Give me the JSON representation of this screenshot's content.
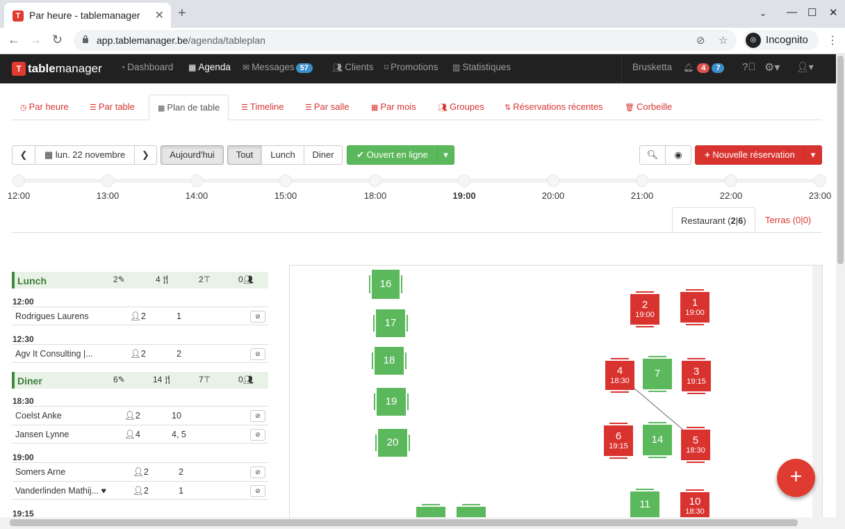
{
  "browser": {
    "tab_title": "Par heure - tablemanager",
    "url_host": "app.tablemanager.be",
    "url_path": "/agenda/tableplan",
    "incognito_label": "Incognito"
  },
  "topnav": {
    "logo_a": "table",
    "logo_b": "manager",
    "items": [
      {
        "label": "Dashboard",
        "icon": "dashboard-icon"
      },
      {
        "label": "Agenda",
        "icon": "calendar-icon"
      },
      {
        "label": "Messages",
        "icon": "envelope-icon",
        "badge": "57"
      },
      {
        "label": "Clients",
        "icon": "users-icon"
      },
      {
        "label": "Promotions",
        "icon": "tag-icon"
      },
      {
        "label": "Statistiques",
        "icon": "bar-chart-icon"
      }
    ],
    "restaurant": "Brusketta",
    "notif_red": "4",
    "notif_blue": "7"
  },
  "subtabs": [
    {
      "label": "Par heure",
      "icon": "clock-icon"
    },
    {
      "label": "Par table",
      "icon": "list-icon"
    },
    {
      "label": "Plan de table",
      "icon": "grid-icon"
    },
    {
      "label": "Timeline",
      "icon": "timeline-icon"
    },
    {
      "label": "Par salle",
      "icon": "list-icon"
    },
    {
      "label": "Par mois",
      "icon": "calendar-icon"
    },
    {
      "label": "Groupes",
      "icon": "group-icon"
    },
    {
      "label": "Réservations récentes",
      "icon": "sort-icon"
    },
    {
      "label": "Corbeille",
      "icon": "trash-icon"
    }
  ],
  "toolbar": {
    "date": "lun. 22 novembre",
    "today": "Aujourd'hui",
    "filters": [
      "Tout",
      "Lunch",
      "Diner"
    ],
    "online": "Ouvert en ligne",
    "new_reservation": "Nouvelle réservation"
  },
  "timeline": [
    "12:00",
    "13:00",
    "14:00",
    "15:00",
    "18:00",
    "19:00",
    "20:00",
    "21:00",
    "22:00",
    "23:00"
  ],
  "timeline_active": "19:00",
  "rooms": {
    "restaurant_label": "Restaurant (",
    "restaurant_a": "2",
    "restaurant_sep": "|",
    "restaurant_b": "6",
    "restaurant_close": ")",
    "terras": "Terras (0|0)"
  },
  "lunch": {
    "title": "Lunch",
    "stats": [
      "2",
      "4",
      "2",
      "0"
    ],
    "groups": [
      {
        "time": "12:00",
        "rows": [
          {
            "name": "Rodrigues Laurens",
            "people": "2",
            "table": "1"
          }
        ]
      },
      {
        "time": "12:30",
        "rows": [
          {
            "name": "Agv It Consulting |...",
            "people": "2",
            "table": "2"
          }
        ]
      }
    ]
  },
  "diner": {
    "title": "Diner",
    "stats": [
      "6",
      "14",
      "7",
      "0"
    ],
    "groups": [
      {
        "time": "18:30",
        "rows": [
          {
            "name": "Coelst Anke",
            "people": "2",
            "table": "10"
          },
          {
            "name": "Jansen Lynne",
            "people": "4",
            "table": "4, 5"
          }
        ]
      },
      {
        "time": "19:00",
        "rows": [
          {
            "name": "Somers Arne",
            "people": "2",
            "table": "2"
          },
          {
            "name": "Vanderlinden Mathij...",
            "people": "2",
            "table": "1"
          }
        ]
      },
      {
        "time": "19:15",
        "rows": []
      }
    ]
  },
  "tables": [
    {
      "n": "16",
      "t": ""
    },
    {
      "n": "17",
      "t": ""
    },
    {
      "n": "18",
      "t": ""
    },
    {
      "n": "19",
      "t": ""
    },
    {
      "n": "20",
      "t": ""
    },
    {
      "n": "2",
      "t": "19:00"
    },
    {
      "n": "1",
      "t": "19:00"
    },
    {
      "n": "4",
      "t": "18:30"
    },
    {
      "n": "7",
      "t": ""
    },
    {
      "n": "3",
      "t": "19:15"
    },
    {
      "n": "6",
      "t": "19:15"
    },
    {
      "n": "14",
      "t": ""
    },
    {
      "n": "5",
      "t": "18:30"
    },
    {
      "n": "11",
      "t": ""
    },
    {
      "n": "10",
      "t": "18:30"
    }
  ],
  "colors": {
    "brand": "#e03b30",
    "free": "#5cb85c",
    "booked": "#d9332f"
  }
}
